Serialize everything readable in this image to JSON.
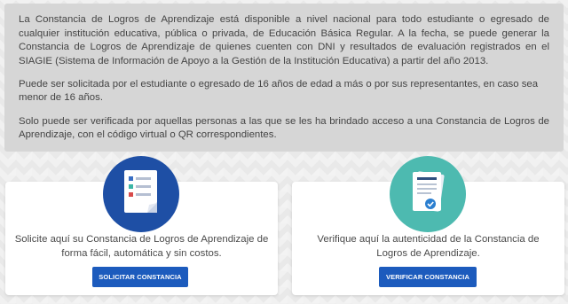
{
  "info": {
    "paragraph1": "La Constancia de Logros de Aprendizaje está disponible a nivel nacional para todo estudiante o egresado de cualquier institución educativa, pública o privada, de Educación Básica Regular. A la fecha, se puede generar la Constancia de Logros de Aprendizaje de quienes cuenten con DNI y resultados de evaluación registrados en el SIAGIE (Sistema de Información de Apoyo a la Gestión de la Institución Educativa) a partir del año 2013.",
    "paragraph2": "Puede ser solicitada por el estudiante o egresado de 16 años de edad a más o por sus representantes, en caso sea menor de 16 años.",
    "paragraph3": "Solo puede ser verificada por aquellas personas a las que se les ha brindado acceso a una Constancia de Logros de Aprendizaje, con el código virtual o QR correspondientes."
  },
  "cards": {
    "request": {
      "icon": "document-list-icon",
      "text": "Solicite aquí su Constancia de Logros de Aprendizaje de forma fácil, automática y sin costos.",
      "button": "SOLICITAR CONSTANCIA"
    },
    "verify": {
      "icon": "certificate-check-icon",
      "text": "Verifique aquí la autenticidad de la Constancia de Logros de Aprendizaje.",
      "button": "VERIFICAR CONSTANCIA"
    }
  },
  "colors": {
    "button": "#1c5bbd",
    "circle_blue": "#1e4fa5",
    "circle_teal": "#4dbab0",
    "info_box": "#d6d6d6"
  }
}
